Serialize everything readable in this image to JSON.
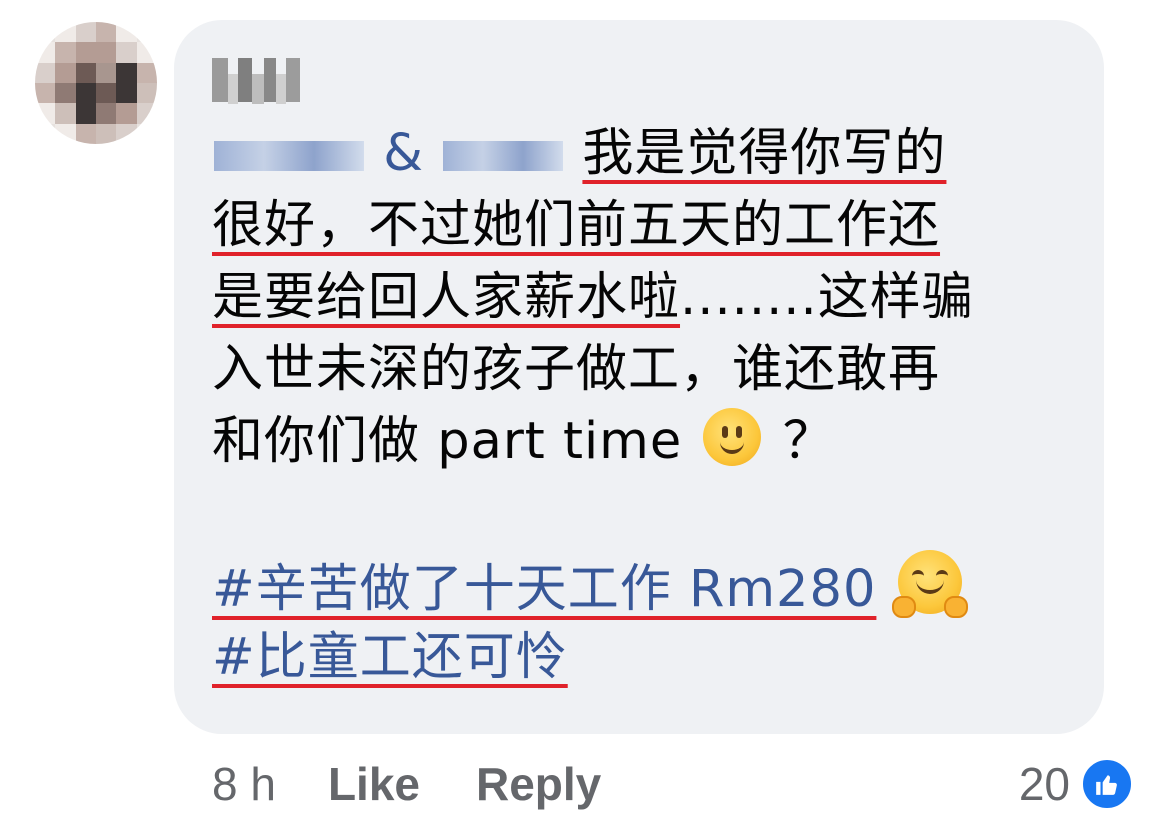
{
  "comment": {
    "mention": "L&I",
    "lines": [
      "我是觉得你写的",
      "很好，不过她们前五天的工作还",
      "是要给回人家薪水啦",
      "........这样骗",
      "入世未深的孩子做工，谁还敢再",
      "和你们做 part time",
      "？"
    ],
    "hashtags": [
      "#辛苦做了十天工作 Rm280",
      "#比童工还可怜"
    ],
    "emojis": [
      "slightly-smiling-face-emoji",
      "hugging-face-emoji"
    ]
  },
  "footer": {
    "time": "8 h",
    "like_label": "Like",
    "reply_label": "Reply",
    "reaction_count": "20"
  },
  "colors": {
    "bubble": "#eff1f4",
    "link": "#385898",
    "text": "#050505",
    "meta": "#65676b",
    "underline": "#e0222a",
    "like": "#1877f2"
  }
}
